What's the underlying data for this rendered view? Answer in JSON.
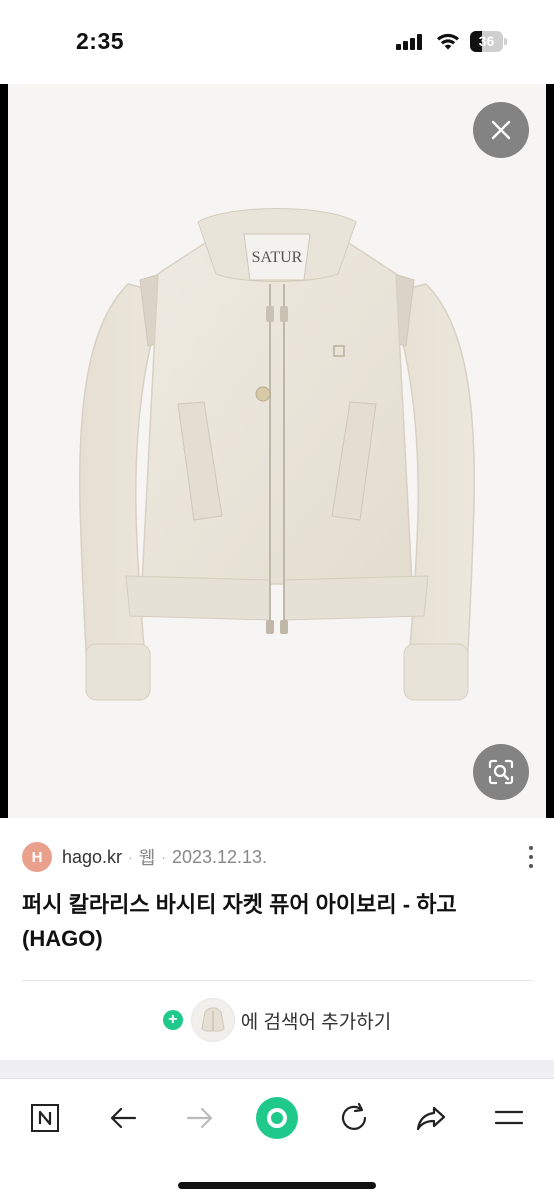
{
  "status_bar": {
    "time": "2:35",
    "battery_level": "36"
  },
  "viewer": {
    "product_label": "SATUR",
    "close_icon": "close-icon",
    "lens_icon": "image-search-icon"
  },
  "result": {
    "favicon_letter": "H",
    "source": "hago.kr",
    "separator": "·",
    "category": "웹",
    "date": "2023.12.13.",
    "title": "퍼시 칼라리스 바시티 자켓 퓨어 아이보리 - 하고(HAGO)",
    "add_plus": "+",
    "add_text": "에 검색어 추가하기"
  },
  "toolbar": {
    "icons": [
      "naver-home-icon",
      "back-arrow-icon",
      "forward-arrow-icon",
      "green-dot-icon",
      "refresh-icon",
      "share-icon",
      "menu-icon"
    ]
  },
  "colors": {
    "accent_green": "#1fc98c",
    "favicon": "#e9a08c",
    "jacket": "#ece7dc"
  }
}
